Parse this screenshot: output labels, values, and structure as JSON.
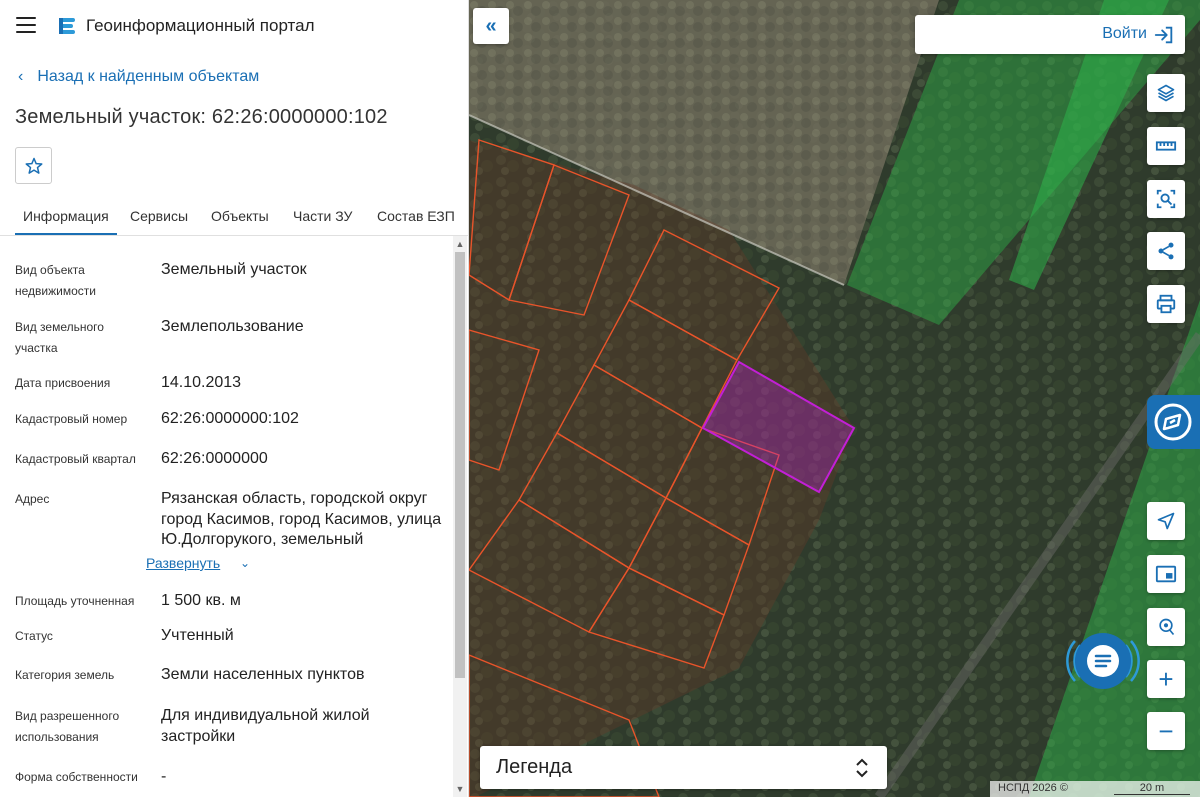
{
  "header": {
    "title": "Геоинформационный портал"
  },
  "nav": {
    "back_label": "Назад к найденным объектам"
  },
  "object": {
    "title": "Земельный участок: 62:26:0000000:102"
  },
  "tabs": [
    {
      "label": "Информация",
      "active": true
    },
    {
      "label": "Сервисы",
      "active": false
    },
    {
      "label": "Объекты",
      "active": false
    },
    {
      "label": "Части ЗУ",
      "active": false
    },
    {
      "label": "Состав ЕЗП",
      "active": false
    }
  ],
  "info": {
    "rows": [
      {
        "label": "Вид объекта недвижимости",
        "value": "Земельный участок"
      },
      {
        "label": "Вид земельного участка",
        "value": "Землепользование"
      },
      {
        "label": "Дата присвоения",
        "value": "14.10.2013"
      },
      {
        "label": "Кадастровый номер",
        "value": "62:26:0000000:102"
      },
      {
        "label": "Кадастровый квартал",
        "value": "62:26:0000000"
      },
      {
        "label": "Адрес",
        "value": "Рязанская область, городской округ город Касимов, город Касимов, улица Ю.Долгорукого, земельный"
      },
      {
        "label": "Площадь уточненная",
        "value": "1 500 кв. м"
      },
      {
        "label": "Статус",
        "value": "Учтенный"
      },
      {
        "label": "Категория земель",
        "value": "Земли населенных пунктов"
      },
      {
        "label": "Вид разрешенного использования",
        "value": "Для индивидуальной жилой застройки"
      },
      {
        "label": "Форма собственности",
        "value": "-"
      }
    ],
    "expand_label": "Развернуть"
  },
  "map": {
    "login_label": "Войти",
    "legend_label": "Легенда",
    "attribution": "НСПД 2026 ©",
    "scale_label": "20 m",
    "tools": [
      "layers-icon",
      "ruler-icon",
      "select-area-icon",
      "share-icon",
      "print-icon",
      "locate-icon",
      "minimap-icon",
      "search-location-icon",
      "zoom-in-icon",
      "zoom-out-icon"
    ]
  },
  "colors": {
    "accent": "#1a6fb4",
    "parcel_outline": "#e8542a",
    "selected_parcel": "#c21fd6",
    "forest_overlay": "#2eb34a"
  }
}
